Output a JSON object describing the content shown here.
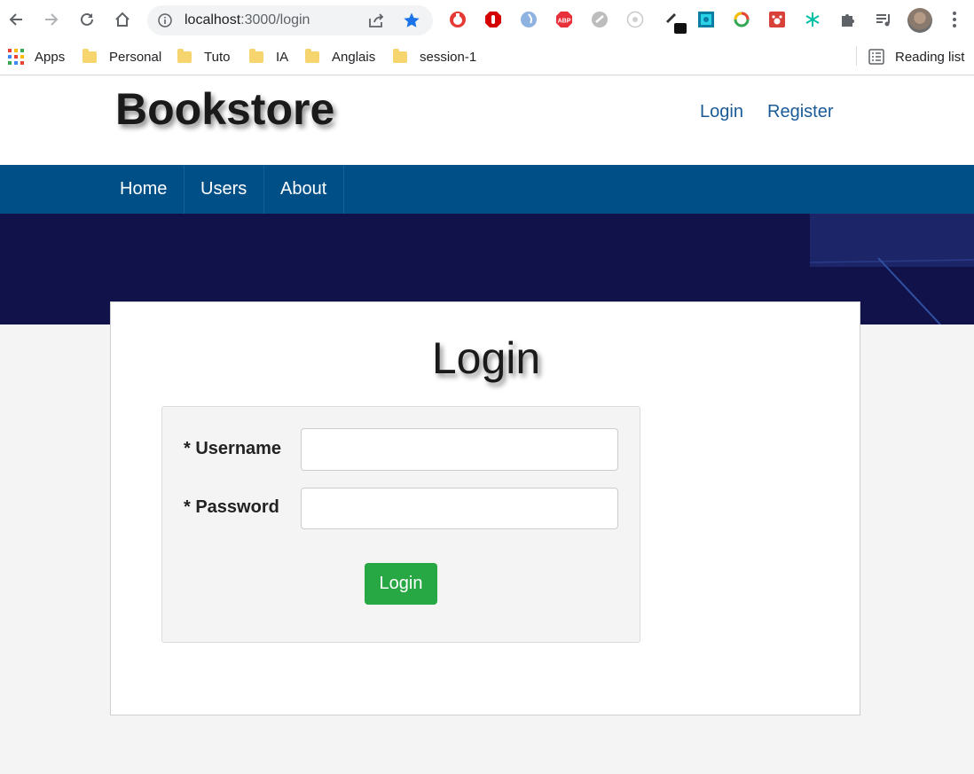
{
  "browser": {
    "url_host": "localhost",
    "url_path": ":3000/login",
    "bookmarks": [
      {
        "label": "Apps"
      },
      {
        "label": "Personal"
      },
      {
        "label": "Tuto"
      },
      {
        "label": "IA"
      },
      {
        "label": "Anglais"
      },
      {
        "label": "session-1"
      }
    ],
    "reading_list": "Reading list",
    "extension_icons": [
      "adblock-ublock-icon",
      "stop-hand-icon",
      "drop-icon",
      "abp-icon",
      "link-circle-icon",
      "scale-icon",
      "pen-icon",
      "square-target-icon",
      "rainbow-ring-icon",
      "paw-icon",
      "snowflake-icon",
      "puzzle-icon",
      "media-list-icon"
    ],
    "abp_text": "ABP",
    "colors": {
      "star": "#1a73e8",
      "tab_bg": "#f1f3f4"
    }
  },
  "site": {
    "brand": "Bookstore",
    "header_links": {
      "login": "Login",
      "register": "Register"
    },
    "nav": {
      "home": "Home",
      "users": "Users",
      "about": "About"
    },
    "colors": {
      "navbar": "#004f87",
      "banner": "#12124a",
      "link": "#1a5a96",
      "button": "#28a745"
    }
  },
  "login_form": {
    "title": "Login",
    "username_label": "* Username",
    "username_value": "",
    "password_label": "* Password",
    "password_value": "",
    "submit_label": "Login"
  }
}
